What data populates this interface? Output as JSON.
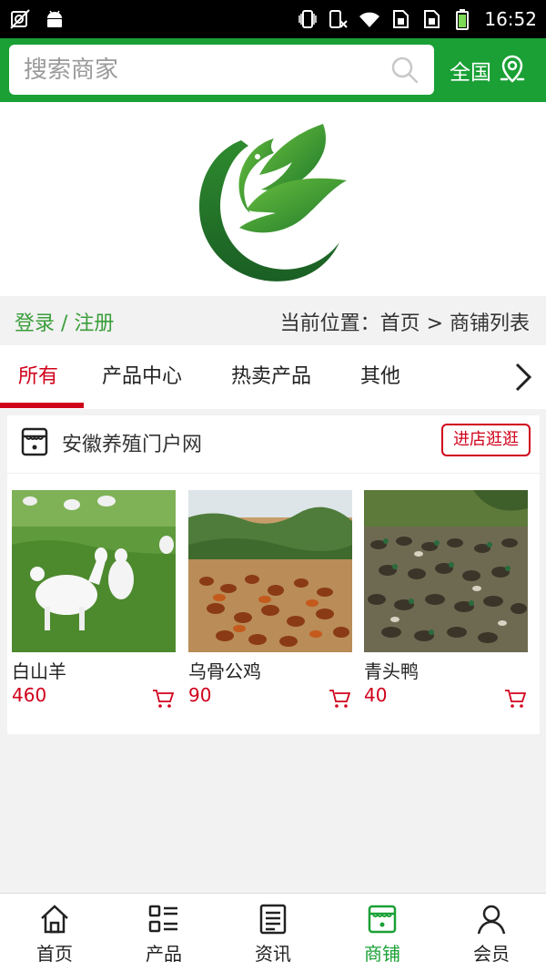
{
  "status_bar": {
    "time": "16:52",
    "icons": [
      "no-sim-icon",
      "android-icon",
      "vibrate-icon",
      "phone-wifi-icon",
      "wifi-icon",
      "sim1-icon",
      "sim2-icon",
      "battery-icon"
    ]
  },
  "header": {
    "search_placeholder": "搜索商家",
    "region_label": "全国",
    "brand_color": "#1aa035"
  },
  "crumb": {
    "login_label": "登录 / 注册",
    "location_text": "当前位置：首页 > 商铺列表"
  },
  "tabs": [
    {
      "label": "所有",
      "active": true
    },
    {
      "label": "产品中心",
      "active": false
    },
    {
      "label": "热卖产品",
      "active": false
    },
    {
      "label": "其他",
      "active": false
    }
  ],
  "shop": {
    "name": "安徽养殖门户网",
    "visit_label": "进店逛逛",
    "products": [
      {
        "name": "白山羊",
        "price": "460"
      },
      {
        "name": "乌骨公鸡",
        "price": "90"
      },
      {
        "name": "青头鸭",
        "price": "40"
      }
    ]
  },
  "bottom_nav": [
    {
      "label": "首页",
      "icon": "home-icon",
      "active": false
    },
    {
      "label": "产品",
      "icon": "product-list-icon",
      "active": false
    },
    {
      "label": "资讯",
      "icon": "news-icon",
      "active": false
    },
    {
      "label": "商铺",
      "icon": "store-icon",
      "active": true
    },
    {
      "label": "会员",
      "icon": "member-icon",
      "active": false
    }
  ],
  "colors": {
    "accent_red": "#d0021b",
    "link_green": "#3a9e3a"
  }
}
